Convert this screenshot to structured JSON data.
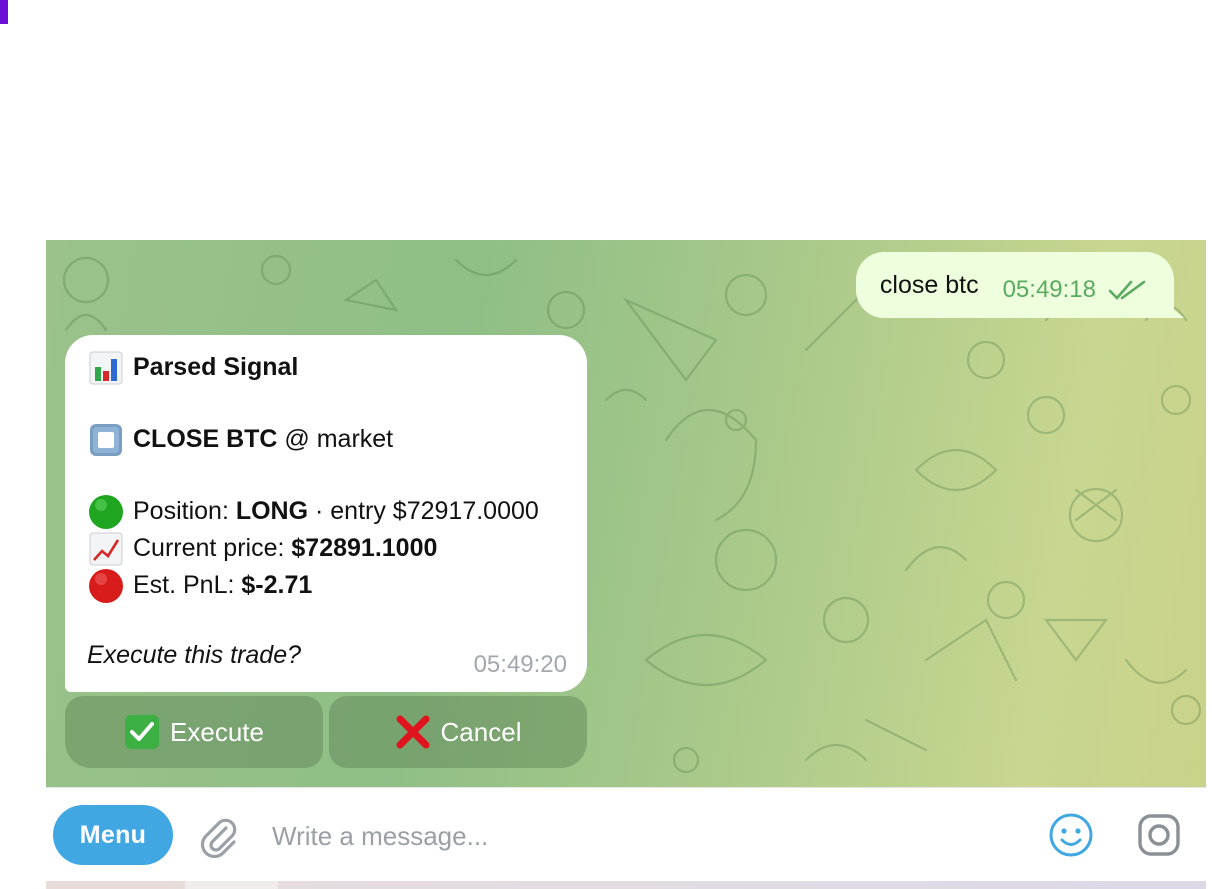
{
  "chat": {
    "outgoing": {
      "text": "close btc",
      "time": "05:49:18",
      "status_icon": "double-check-icon"
    },
    "incoming": {
      "title_icon": "bar-chart-emoji",
      "title": "Parsed Signal",
      "action_icon": "stop-button-emoji",
      "action_bold": "CLOSE BTC",
      "action_rest": " @ market",
      "position_icon": "green-circle-emoji",
      "position_label": "Position: ",
      "position_value": "LONG",
      "position_rest": " · entry $72917.0000",
      "price_icon": "chart-increasing-emoji",
      "price_label": "Current price: ",
      "price_value": "$72891.1000",
      "pnl_icon": "red-circle-emoji",
      "pnl_label": "Est. PnL: ",
      "pnl_value": "$-2.71",
      "prompt": "Execute this trade?",
      "time": "05:49:20"
    },
    "keyboard": [
      {
        "label": "Execute",
        "icon": "check-mark-button-emoji",
        "color": "#3cb043"
      },
      {
        "label": "Cancel",
        "icon": "cross-mark-emoji",
        "color": "#e0141e"
      }
    ]
  },
  "composer": {
    "menu_label": "Menu",
    "placeholder": "Write a message...",
    "attach_icon": "paperclip-icon",
    "emoji_icon": "smile-icon",
    "camera_icon": "camera-icon",
    "accent": "#40a7e3"
  }
}
